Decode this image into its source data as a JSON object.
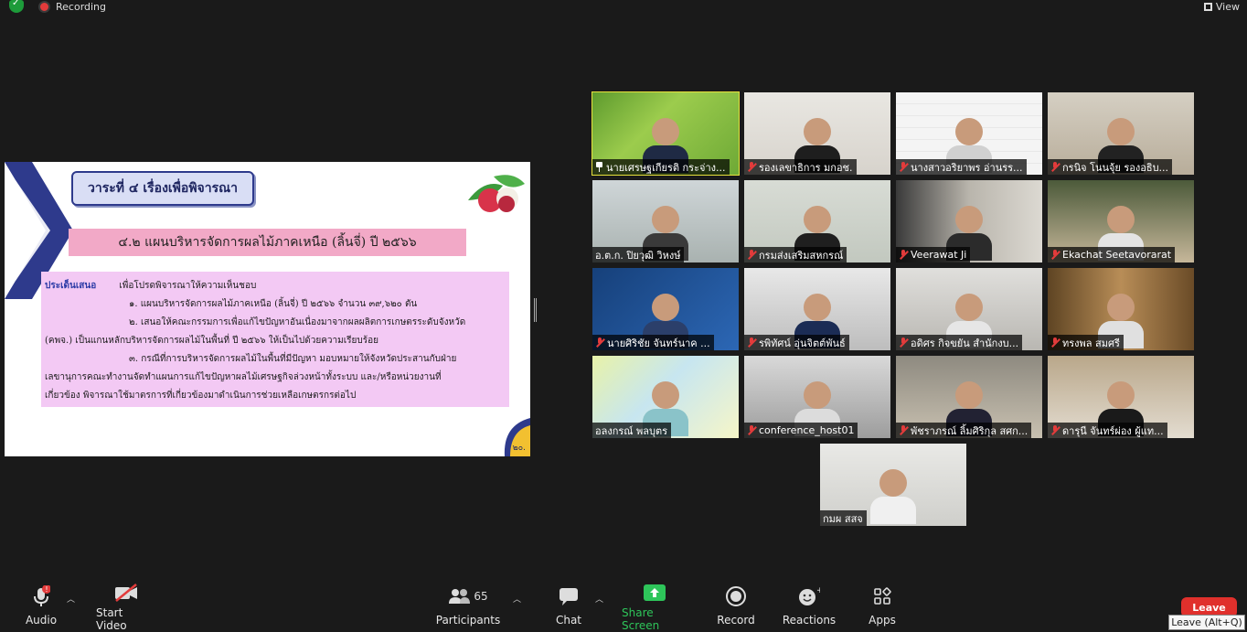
{
  "topbar": {
    "recording": "Recording",
    "view": "View"
  },
  "slide": {
    "agenda_title": "วาระที่ ๔ เรื่องเพื่อพิจารณา",
    "subtitle": "๔.๒ แผนบริหารจัดการผลไม้ภาคเหนือ (ลิ้นจี่) ปี ๒๕๖๖",
    "label": "ประเด็นเสนอ",
    "lines": [
      "เพื่อโปรดพิจารณาให้ความเห็นชอบ",
      "๑. แผนบริหารจัดการผลไม้ภาคเหนือ (ลิ้นจี่) ปี ๒๕๖๖ จำนวน ๓๙,๖๒๐ ตัน",
      "๒. เสนอให้คณะกรรมการเพื่อแก้ไขปัญหาอันเนื่องมาจากผลผลิตการเกษตรระดับจังหวัด",
      "(คพจ.) เป็นแกนหลักบริหารจัดการผลไม้ในพื้นที่ ปี ๒๕๖๖ ให้เป็นไปด้วยความเรียบร้อย",
      "๓. กรณีที่การบริหารจัดการผลไม้ในพื้นที่มีปัญหา มอบหมายให้จังหวัดประสานกับฝ่าย",
      "เลขานุการคณะทำงานจัดทำแผนการแก้ไขปัญหาผลไม้เศรษฐกิจล่วงหน้าทั้งระบบ และ/หรือหน่วยงานที่",
      "เกี่ยวข้อง พิจารณาใช้มาตรการที่เกี่ยวข้องมาดำเนินการช่วยเหลือเกษตรกรต่อไป"
    ],
    "page_number": "๒๐."
  },
  "participants": [
    {
      "name": "นายเศรษฐเกียรติ กระจ่าง...",
      "muted": false,
      "pinned": true,
      "active": true
    },
    {
      "name": "รองเลขาธิการ มกอช.",
      "muted": true
    },
    {
      "name": "นางสาวอริยาพร อ่านรร...",
      "muted": true
    },
    {
      "name": "กรนิจ โนนจุ้ย รองอธิบ...",
      "muted": true
    },
    {
      "name": "อ.ต.ก. ปิยวุฒิ วิหงษ์",
      "muted": false
    },
    {
      "name": "กรมส่งเสริมสหกรณ์",
      "muted": true
    },
    {
      "name": "Veerawat Ji",
      "muted": true
    },
    {
      "name": "Ekachat Seetavorarat",
      "muted": true
    },
    {
      "name": "นายศิริชัย จันทร์นาค ...",
      "muted": true
    },
    {
      "name": "รพิทัศน์ อุ่นจิตต์พันธ์",
      "muted": true
    },
    {
      "name": "อดิศร กิจขยัน สำนักงบ...",
      "muted": true
    },
    {
      "name": "ทรงพล สมศรี",
      "muted": true
    },
    {
      "name": "อลงกรณ์ พลบุตร",
      "muted": false
    },
    {
      "name": "conference_host01",
      "muted": true
    },
    {
      "name": "พัชราภรณ์ ลิ้มศิริกุล สศก...",
      "muted": true
    },
    {
      "name": "ดารุนี จันทร์ผ่อง ผู้แท...",
      "muted": true
    },
    {
      "name": "กมผ สสจ",
      "muted": false
    }
  ],
  "toolbar": {
    "audio": "Audio",
    "video": "Start Video",
    "participants": "Participants",
    "participant_count": "65",
    "chat": "Chat",
    "share": "Share Screen",
    "record": "Record",
    "reactions": "Reactions",
    "apps": "Apps",
    "leave": "Leave",
    "leave_tooltip": "Leave (Alt+Q)"
  },
  "colors": {
    "accent_green": "#2ec55a",
    "leave_red": "#e0302c",
    "active_speaker": "#e7e13c"
  }
}
